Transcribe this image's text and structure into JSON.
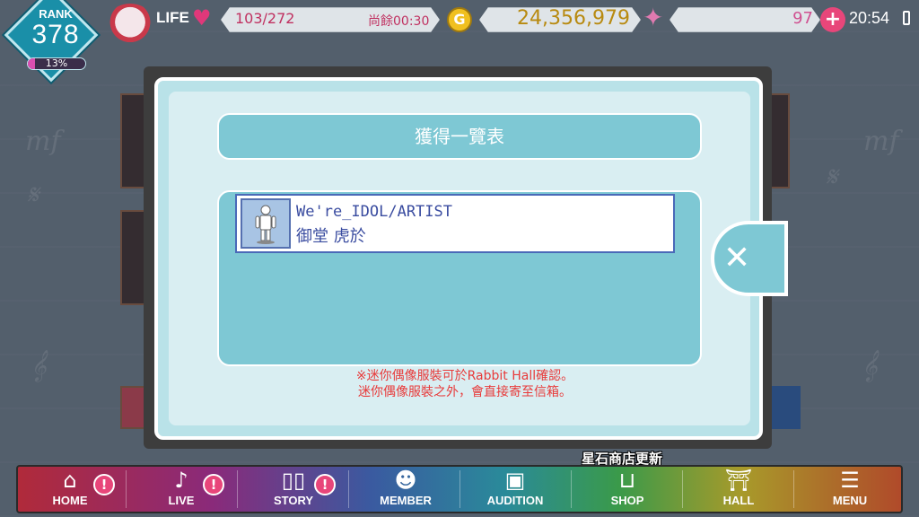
{
  "status_bar": {
    "rank_label": "RANK",
    "rank_value": "378",
    "rank_progress_percent": 13,
    "rank_progress_text": "13%",
    "life_label": "LIFE",
    "life_value": "103/272",
    "life_timer": "尚餘00:30",
    "gold_symbol": "G",
    "gold_value": "24,356,979",
    "gem_value": "97",
    "plus_symbol": "+",
    "clock": "20:54"
  },
  "modal": {
    "title": "獲得一覽表",
    "items": [
      {
        "title": "We're_IDOL/ARTIST",
        "owner": "御堂 虎於"
      }
    ],
    "note_line1": "※迷你偶像服裝可於Rabbit Hall確認。",
    "note_line2": "迷你偶像服裝之外，會直接寄至信箱。",
    "close_symbol": "✕"
  },
  "shop_notice": "星石商店更新",
  "nav": {
    "items": [
      {
        "label": "HOME",
        "icon": "home-icon",
        "badge": "!"
      },
      {
        "label": "LIVE",
        "icon": "music-note-icon",
        "badge": "!"
      },
      {
        "label": "STORY",
        "icon": "book-icon",
        "badge": "!"
      },
      {
        "label": "MEMBER",
        "icon": "member-icon"
      },
      {
        "label": "AUDITION",
        "icon": "audition-card-icon"
      },
      {
        "label": "SHOP",
        "icon": "shop-basket-icon"
      },
      {
        "label": "HALL",
        "icon": "hall-gate-icon"
      },
      {
        "label": "MENU",
        "icon": "menu-list-icon"
      }
    ]
  },
  "colors": {
    "modal_bg": "#b9e2e8",
    "panel": "#7ec8d4",
    "item_border": "#4a69b8",
    "note_red": "#e83a3a",
    "badge_pink": "#e8467a"
  }
}
